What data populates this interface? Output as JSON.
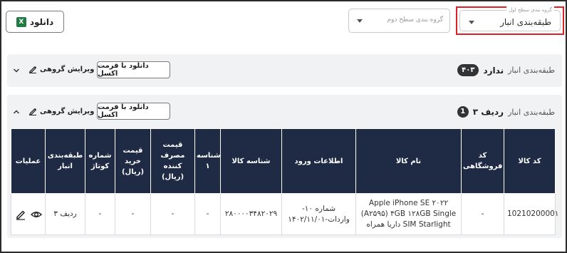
{
  "toolbar": {
    "level1_select": {
      "label": "گروه بندی سطح اول",
      "value": "طبقه‌بندی انبار"
    },
    "level2_select": {
      "placeholder": "گروه بندی سطح دوم"
    },
    "download_label": "دانلود",
    "excel_icon_letter": "X"
  },
  "groups": [
    {
      "label": "طبقه‌بندی انبار",
      "value": "ندارد",
      "count": "۴۰۳",
      "download_excel_label": "دانلود با فرمت اکسل",
      "edit_group_label": "ویرایش گروهی",
      "expanded": false
    },
    {
      "label": "طبقه‌بندی انبار",
      "value": "ردیف ۳",
      "count": "1",
      "download_excel_label": "دانلود با فرمت اکسل",
      "edit_group_label": "ویرایش گروهی",
      "expanded": true
    }
  ],
  "table": {
    "headers": {
      "code": "کد کالا",
      "store_code": "کد فروشگاهی",
      "name": "نام کالا",
      "entry": "اطلاعات ورود",
      "id": "شناسه کالا",
      "id1": "شناسه ۱",
      "consumer_price": "قیمت مصرف کننده (ریال)",
      "buy_price": "قیمت خرید (ریال)",
      "container": "شماره کوتاژ",
      "category": "طبقه‌بندی انبار",
      "ops": "عملیات"
    },
    "row": {
      "code": "1021020000۱",
      "store_code": "-",
      "name": "Apple iPhone SE ۲۰۲۲ (A۲۵۹۵) ۴GB ۱۲۸GB Single SIM Starlight داریا همراه",
      "entry": "شماره ۱۰- واردات-۱۴۰۲/۱۱/۰۱",
      "id": "۲۸۰۰۰۰۳۴۸۲۰۲۹",
      "id1": "-",
      "consumer_price": "-",
      "buy_price": "-",
      "container": "-",
      "category": "ردیف ۳"
    }
  }
}
